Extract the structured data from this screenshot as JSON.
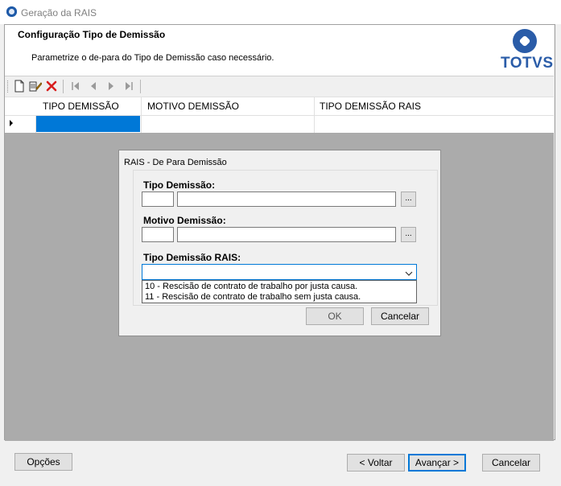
{
  "window": {
    "title": "Geração da RAIS"
  },
  "header": {
    "title": "Configuração Tipo de Demissão",
    "subtitle": "Parametrize o de-para do Tipo de Demissão caso necessário.",
    "brand": "TOTVS"
  },
  "toolbar": {
    "icons": [
      "new-icon",
      "edit-icon",
      "delete-icon",
      "first-icon",
      "previous-icon",
      "next-icon",
      "last-icon"
    ]
  },
  "grid": {
    "columns": [
      "TIPO DEMISSÃO",
      "MOTIVO DEMISSÃO",
      "TIPO DEMISSÃO RAIS"
    ],
    "selection_color": "#0078d7"
  },
  "dialog": {
    "title": "RAIS - De Para Demissão",
    "tipo_label": "Tipo Demissão:",
    "motivo_label": "Motivo Demissão:",
    "rais_label": "Tipo Demissão RAIS:",
    "ellipsis": "...",
    "options": [
      "10 - Rescisão de contrato de trabalho por justa causa.",
      "11 - Rescisão de contrato de trabalho sem justa causa."
    ],
    "ok_label": "OK",
    "cancel_label": "Cancelar"
  },
  "footer": {
    "options_label": "Opções",
    "back_label": "< Voltar",
    "next_label": "Avançar >",
    "cancel_label": "Cancelar"
  },
  "colors": {
    "brand": "#2a5ca8",
    "accent": "#0078d7",
    "overlay": "#ababab"
  }
}
